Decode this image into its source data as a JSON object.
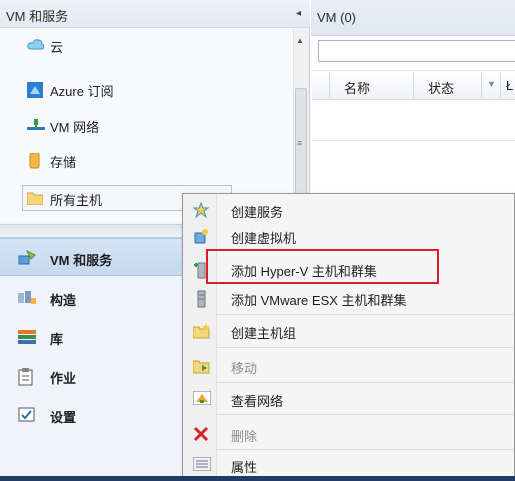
{
  "left_pane": {
    "title": "VM 和服务",
    "collapse_icon": "◂",
    "tree": [
      {
        "label": "云",
        "icon": "cloud-icon"
      },
      {
        "label": "Azure 订阅",
        "icon": "azure-subscription-icon"
      },
      {
        "label": "VM 网络",
        "icon": "vm-network-icon"
      },
      {
        "label": "存储",
        "icon": "storage-icon"
      },
      {
        "label": "所有主机",
        "icon": "folder-icon"
      }
    ],
    "workspaces": [
      {
        "label": "VM 和服务",
        "icon": "vm-services-icon",
        "selected": true
      },
      {
        "label": "构造",
        "icon": "fabric-icon"
      },
      {
        "label": "库",
        "icon": "library-icon"
      },
      {
        "label": "作业",
        "icon": "jobs-icon"
      },
      {
        "label": "设置",
        "icon": "settings-icon"
      }
    ]
  },
  "right_pane": {
    "title": "VM (0)",
    "search_value": "",
    "columns": [
      "名称",
      "状态",
      "Ł"
    ],
    "sort_icon": "▼"
  },
  "context_menu": {
    "items": [
      {
        "label": "创建服务",
        "icon": "create-service-icon",
        "enabled": true
      },
      {
        "label": "创建虚拟机",
        "icon": "create-vm-icon",
        "enabled": true
      },
      {
        "label": "添加 Hyper-V 主机和群集",
        "icon": "add-hyperv-host-icon",
        "enabled": true,
        "highlighted": true
      },
      {
        "label": "添加 VMware ESX 主机和群集",
        "icon": "add-vmware-host-icon",
        "enabled": true
      },
      {
        "label": "创建主机组",
        "icon": "create-host-group-icon",
        "enabled": true
      },
      {
        "label": "移动",
        "icon": "move-icon",
        "enabled": false
      },
      {
        "label": "查看网络",
        "icon": "view-network-icon",
        "enabled": true
      },
      {
        "label": "删除",
        "icon": "delete-icon",
        "enabled": false
      },
      {
        "label": "属性",
        "icon": "properties-icon",
        "enabled": true
      }
    ],
    "highlight_color": "#d9202a"
  },
  "colors": {
    "accent": "#c4d8ef",
    "nav_background": "#f0f4fa",
    "menu_background": "#f5f5f5"
  }
}
